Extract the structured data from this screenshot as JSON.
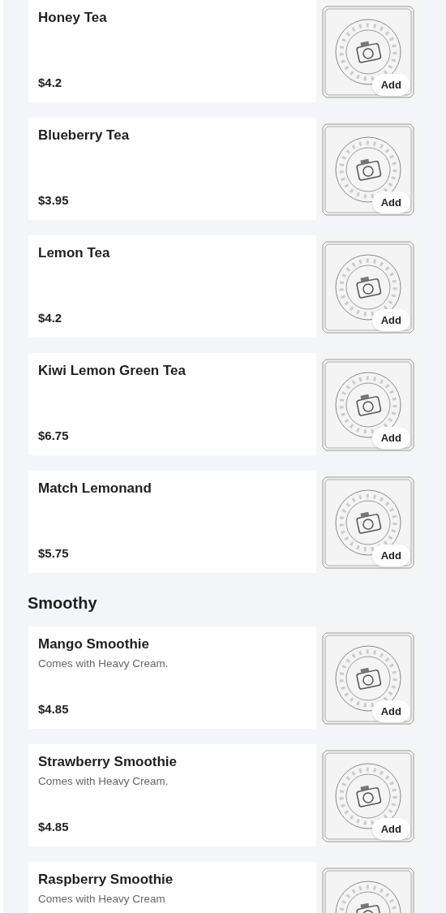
{
  "sections": [
    {
      "items": [
        {
          "name": "Honey Tea",
          "price": "$4.2",
          "button": "Add"
        },
        {
          "name": "Blueberry Tea",
          "price": "$3.95",
          "button": "Add"
        },
        {
          "name": "Lemon Tea",
          "price": "$4.2",
          "button": "Add"
        },
        {
          "name": "Kiwi Lemon Green Tea",
          "price": "$6.75",
          "button": "Add"
        },
        {
          "name": "Match Lemonand",
          "price": "$5.75",
          "button": "Add"
        }
      ]
    },
    {
      "title": "Smoothy",
      "items": [
        {
          "name": "Mango Smoothie",
          "description": "Comes with Heavy Cream.",
          "price": "$4.85",
          "button": "Add"
        },
        {
          "name": "Strawberry Smoothie",
          "description": "Comes with Heavy Cream.",
          "price": "$4.85",
          "button": "Add"
        },
        {
          "name": "Raspberry Smoothie",
          "description": "Comes with Heavy Cream"
        }
      ]
    }
  ]
}
